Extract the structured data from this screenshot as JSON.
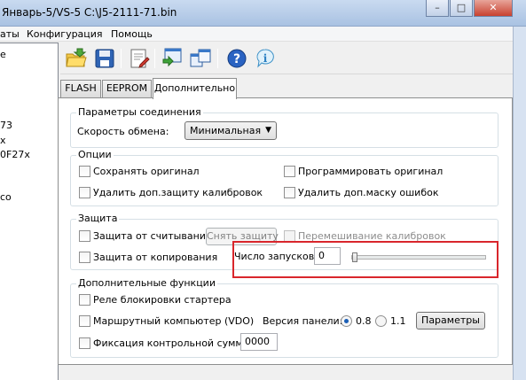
{
  "window": {
    "title": "Январь-5/VS-5 C:\\J5-2111-71.bin"
  },
  "menu": {
    "items": [
      "аты",
      "Конфигурация",
      "Помощь"
    ]
  },
  "left_panel": {
    "items": [
      "e",
      "73",
      "x",
      "0F27x",
      "co"
    ]
  },
  "toolbar": {
    "buttons": [
      "open-folder-icon",
      "save-disk-icon",
      "document-edit-icon",
      "download-window-icon",
      "windows-compare-icon",
      "help-icon",
      "info-icon"
    ]
  },
  "tabs": {
    "flash": "FLASH",
    "eeprom": "EEPROM",
    "extra": "Дополнительно"
  },
  "connection": {
    "title": "Параметры соединения",
    "speed_label": "Скорость обмена:",
    "speed_value": "Минимальная"
  },
  "options": {
    "title": "Опции",
    "save_original": "Сохранять оригинал",
    "program_original": "Программировать оригинал",
    "remove_calib_protection": "Удалить доп.защиту калибровок",
    "remove_error_mask": "Удалить доп.маску ошибок"
  },
  "protection": {
    "title": "Защита",
    "read_protection": "Защита от считывания",
    "remove_protection_button": "Снять защиту",
    "shuffle_calibrations": "Перемешивание калибровок",
    "copy_protection": "Защита от копирования",
    "launch_count_label": "Число запусков:",
    "launch_count_value": "0",
    "slider_level": 0
  },
  "extra_functions": {
    "title": "Дополнительные функции",
    "starter_lock_relay": "Реле блокировки стартера",
    "route_computer": "Маршрутный компьютер (VDO)",
    "panel_version_label": "Версия панели:",
    "version_08": "0.8",
    "version_11": "1.1",
    "params_button": "Параметры",
    "checksum_fix": "Фиксация контрольной суммы",
    "checksum_value": "0000"
  },
  "colors": {
    "highlight": "#d9262c",
    "accent": "#1b5fb6"
  }
}
